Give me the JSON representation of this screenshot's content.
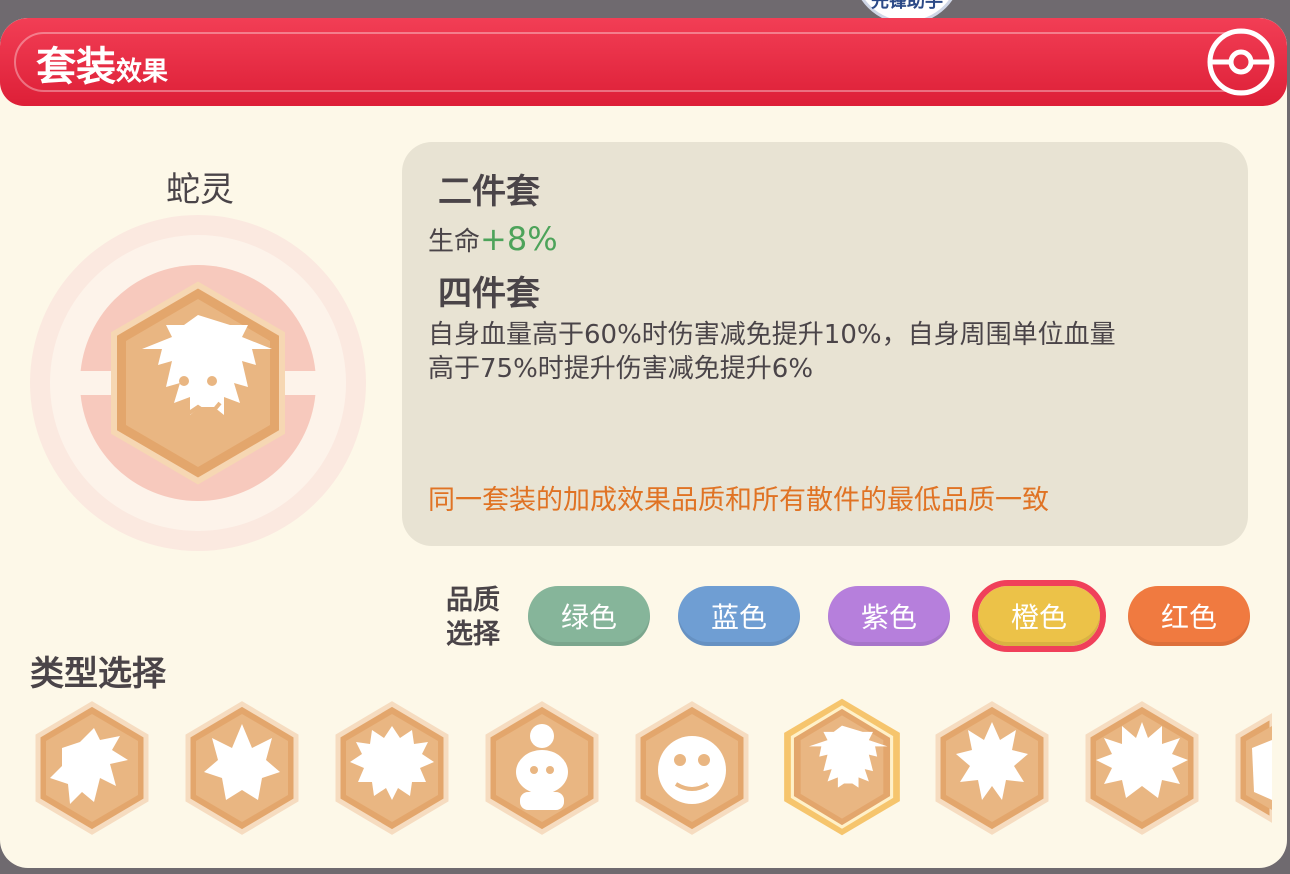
{
  "top_badge": {
    "label": "先锋助手"
  },
  "header": {
    "title_big": "套装",
    "title_small": "效果",
    "icon": "pokeball-icon"
  },
  "set": {
    "name": "蛇灵",
    "two_piece_title": "二件套",
    "two_piece_stat": "生命",
    "two_piece_value": "+8%",
    "four_piece_title": "四件套",
    "four_piece_line1": "自身血量高于60%时伤害减免提升10%，自身周围单位血量",
    "four_piece_line2": "高于75%时提升伤害减免提升6%",
    "note": "同一套装的加成效果品质和所有散件的最低品质一致"
  },
  "quality": {
    "label_line1": "品质",
    "label_line2": "选择",
    "options": [
      {
        "label": "绿色",
        "color": "#86b59a"
      },
      {
        "label": "蓝色",
        "color": "#6f9ed3"
      },
      {
        "label": "紫色",
        "color": "#b67fdc"
      },
      {
        "label": "橙色",
        "color": "#ecc248",
        "selected": true
      },
      {
        "label": "红色",
        "color": "#f07a40"
      }
    ]
  },
  "types": {
    "title": "类型选择",
    "items": [
      {
        "icon": "dragon-emblem-icon"
      },
      {
        "icon": "horned-beast-emblem-icon"
      },
      {
        "icon": "lion-emblem-icon"
      },
      {
        "icon": "fish-emblem-icon"
      },
      {
        "icon": "golem-emblem-icon"
      },
      {
        "icon": "snake-spirit-emblem-icon",
        "selected": true
      },
      {
        "icon": "flame-emblem-icon"
      },
      {
        "icon": "ghost-emblem-icon"
      },
      {
        "icon": "partial-emblem-icon"
      }
    ]
  },
  "colors": {
    "header": "#e5283f",
    "panel": "#fdf8e8",
    "desc_box": "#e8e3d3",
    "emblem": "#e7b27e",
    "note": "#e07324",
    "value_green": "#4da35a"
  }
}
